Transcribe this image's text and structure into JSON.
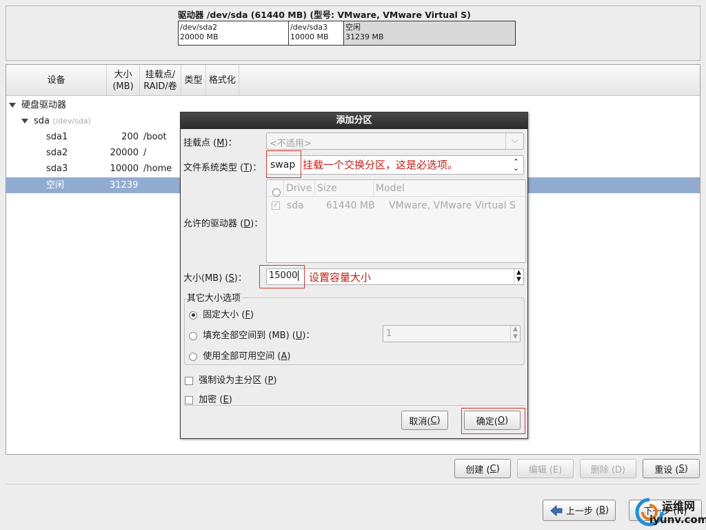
{
  "drive": {
    "title": "驱动器 /dev/sda (61440 MB) (型号: VMware, VMware Virtual S)",
    "segments": [
      {
        "name": "/dev/sda2",
        "size": "20000 MB"
      },
      {
        "name": "/dev/sda3",
        "size": "10000 MB"
      },
      {
        "name": "空闲",
        "size": "31239 MB"
      }
    ]
  },
  "table": {
    "headers": {
      "device": "设备",
      "size_line1": "大小",
      "size_line2": "(MB)",
      "mount_line1": "挂载点/",
      "mount_line2": "RAID/卷",
      "type": "类型",
      "format": "格式化"
    },
    "group": "硬盘驱动器",
    "disk": {
      "name": "sda",
      "path": "(/dev/sda)"
    },
    "rows": [
      {
        "device": "sda1",
        "size": "200",
        "mount": "/boot"
      },
      {
        "device": "sda2",
        "size": "20000",
        "mount": "/"
      },
      {
        "device": "sda3",
        "size": "10000",
        "mount": "/home"
      },
      {
        "device": "空闲",
        "size": "31239",
        "mount": ""
      }
    ]
  },
  "dialog": {
    "title": "添加分区",
    "mount_label": "挂载点 (",
    "mount_key": "M",
    "mount_label_end": ")：",
    "mount_value": "<不适用>",
    "fstype_label": "文件系统类型 (",
    "fstype_key": "T",
    "fstype_label_end": ")：",
    "fstype_value": "swap",
    "fstype_annotation": "挂载一个交换分区，这是必选项。",
    "drives_label": "允许的驱动器 (",
    "drives_key": "D",
    "drives_label_end": ")：",
    "drives_columns": {
      "drive": "Drive",
      "size": "Size",
      "model": "Model"
    },
    "drives_row": {
      "drive": "sda",
      "size": "61440 MB",
      "model": "VMware, VMware Virtual S"
    },
    "size_label": "大小(MB) (",
    "size_key": "S",
    "size_label_end": ")：",
    "size_value": "15000",
    "size_annotation": "设置容量大小",
    "other_group": "其它大小选项",
    "opt_fixed": "固定大小 (",
    "opt_fixed_key": "F",
    "opt_fill": "填充全部空间到 (MB) (",
    "opt_fill_key": "U",
    "opt_fill_end": ")：",
    "opt_fill_value": "1",
    "opt_all": "使用全部可用空间 (",
    "opt_all_key": "A",
    "force_primary": "强制设为主分区 (",
    "force_primary_key": "P",
    "encrypt": "加密 (",
    "encrypt_key": "E",
    "close_paren": ")",
    "cancel": "取消(",
    "cancel_key": "C",
    "ok": "确定(",
    "ok_key": "O"
  },
  "actions": {
    "create": "创建 (",
    "create_key": "C",
    "edit": "编辑 (E)",
    "delete": "删除 (D)",
    "reset": "重设 (",
    "reset_key": "S",
    "close_paren": ")"
  },
  "nav": {
    "back": "上一步 (",
    "back_key": "B",
    "close_paren": ")",
    "next": "下一步 (N)"
  },
  "watermark": {
    "text1": "运维网",
    "text2": "iyunv.com"
  },
  "colors": {
    "selection": "#92acd1",
    "annotation": "#d8342e",
    "dialog_title_bg": "#333333"
  }
}
